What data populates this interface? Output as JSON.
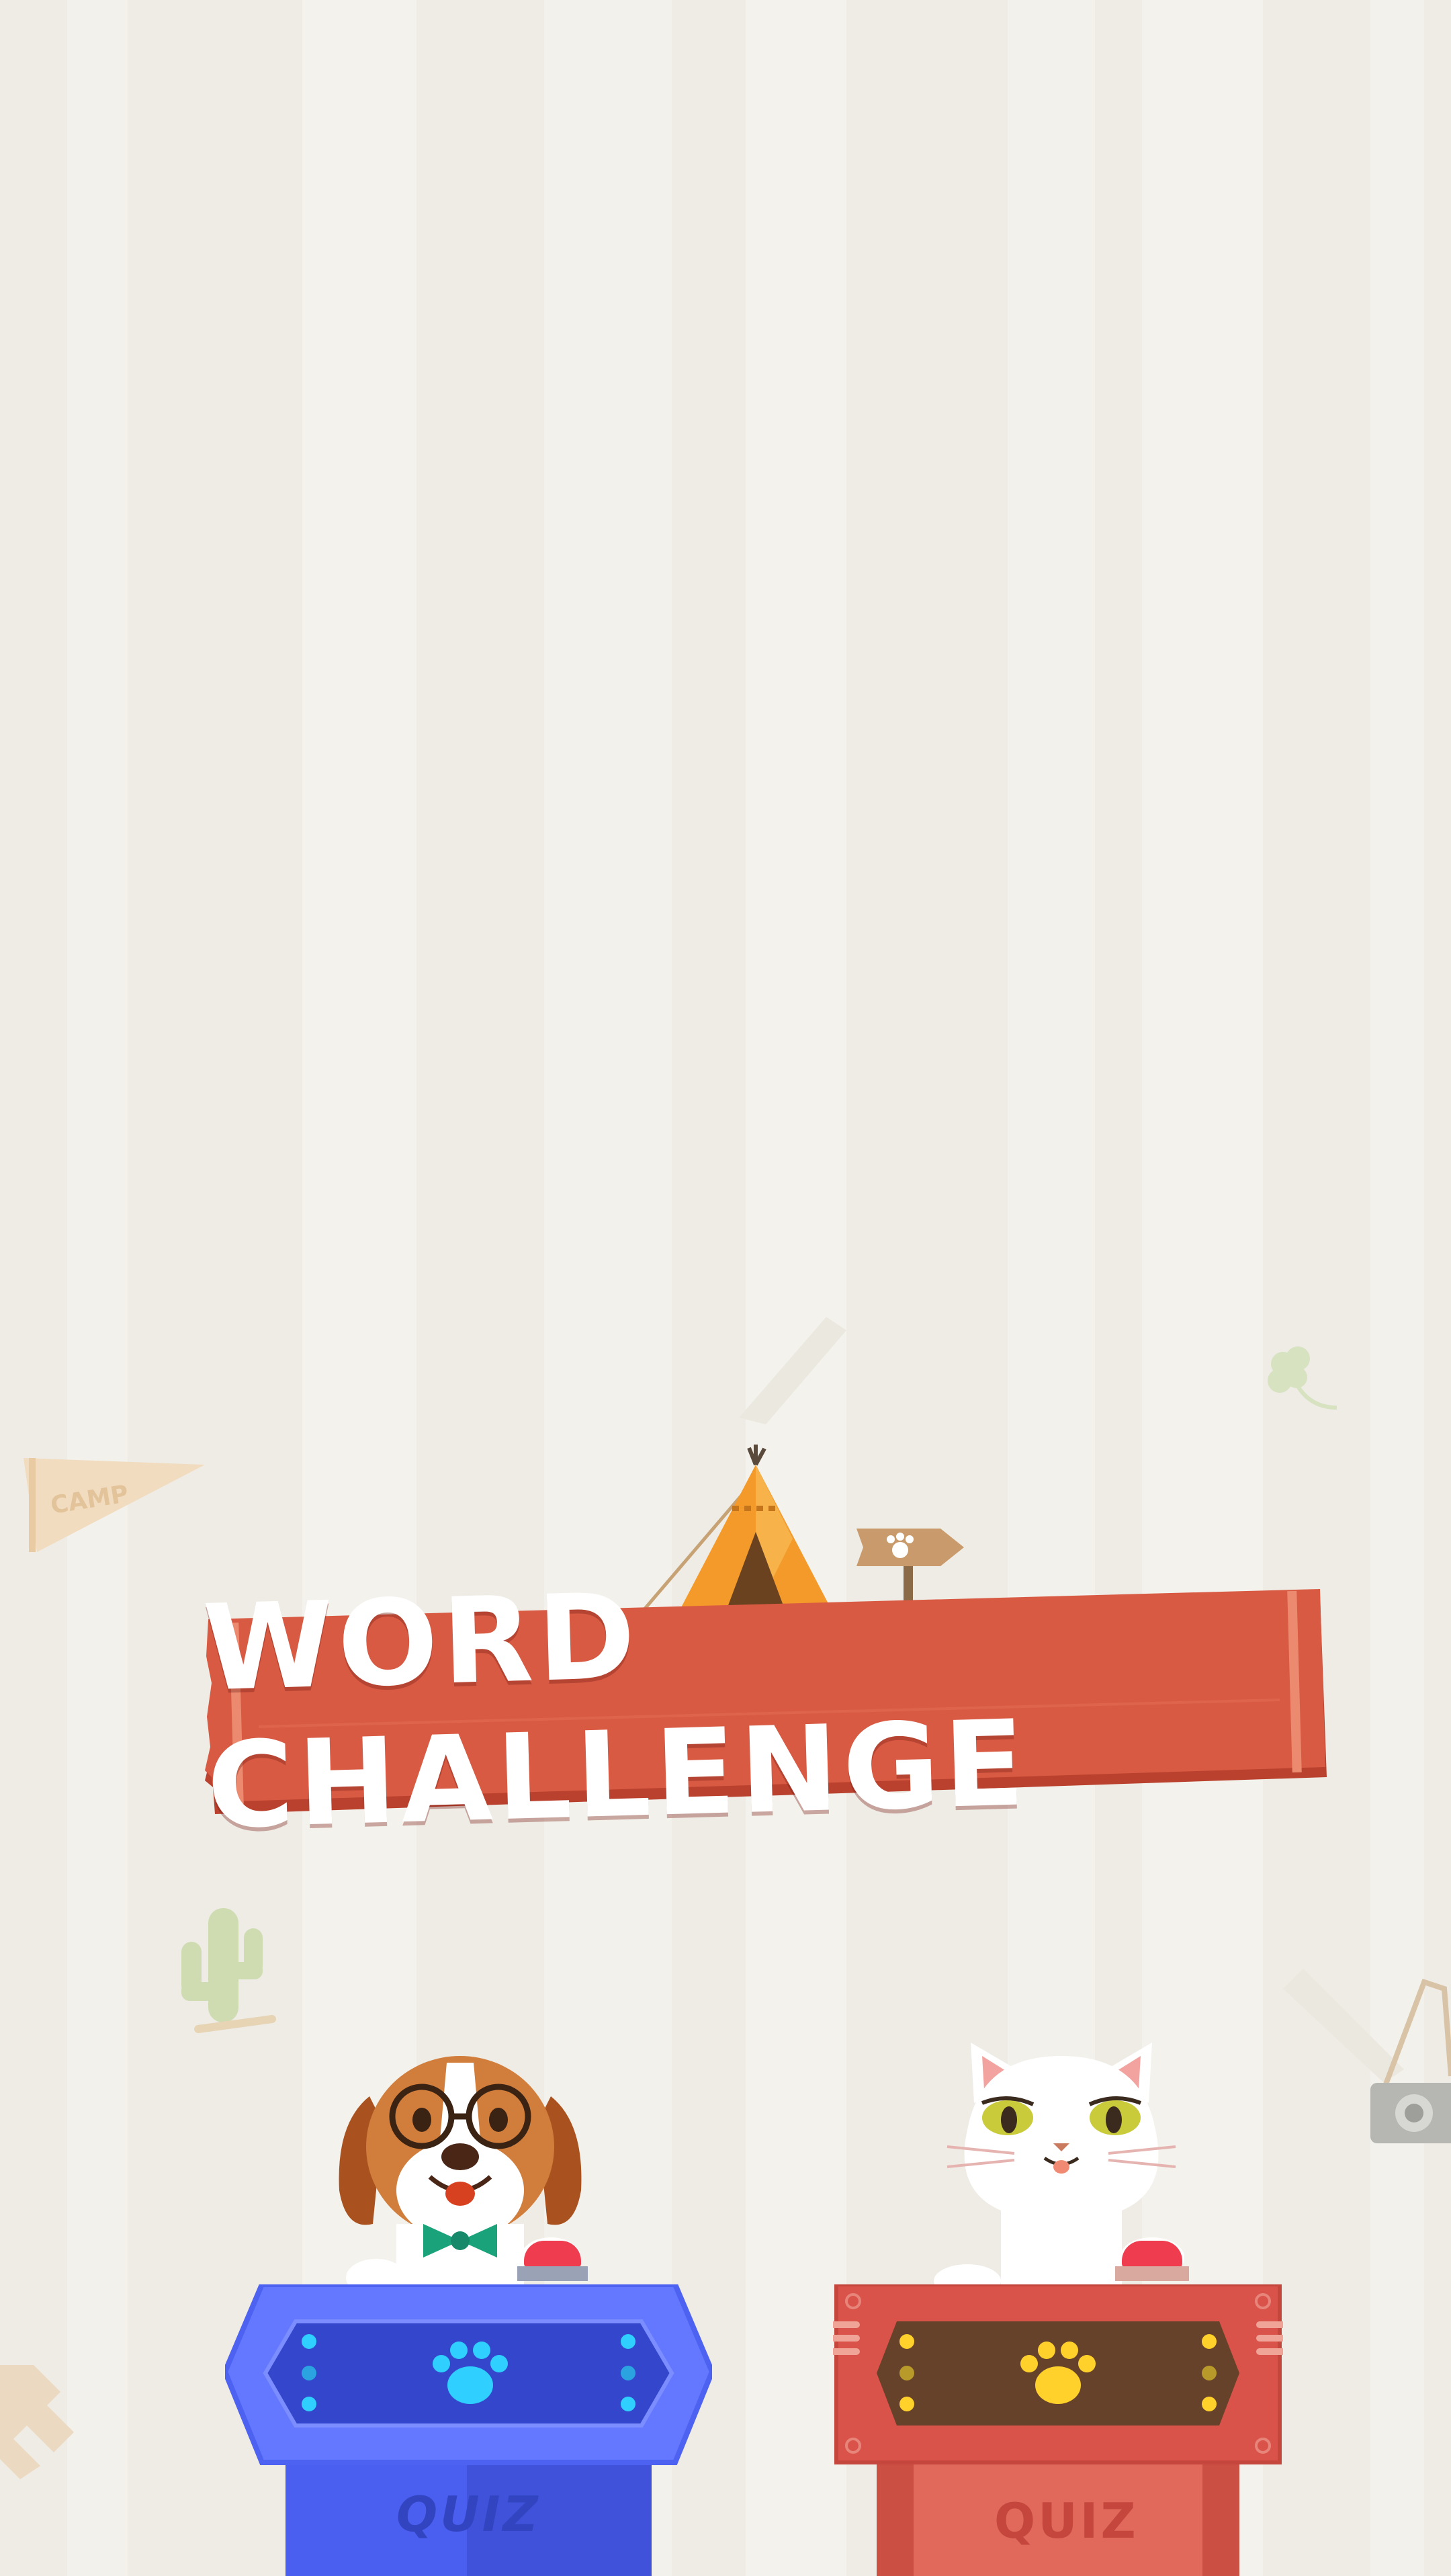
{
  "game": {
    "title": "WORD CHALLENGE",
    "pennant_text": "CAMP",
    "player_left": {
      "name": "dog",
      "podium_label": "QUIZ",
      "podium_color": "#4a5ff0"
    },
    "player_right": {
      "name": "cat",
      "podium_label": "QUIZ",
      "podium_color": "#d9534a"
    }
  },
  "colors": {
    "background": "#efece5",
    "banner": "#d85a43",
    "banner_edge": "#b9412e",
    "blue_podium": "#4a5ff0",
    "red_podium": "#d9534a",
    "paw_blue": "#2fd0ff",
    "paw_yellow": "#ffd12a"
  },
  "icons": {
    "tent": "tent-icon",
    "signpost": "signpost-icon",
    "clover": "clover-icon",
    "cactus": "cactus-icon",
    "camera": "camera-icon",
    "pennant": "pennant-icon",
    "dog": "dog-character",
    "cat": "cat-character"
  }
}
